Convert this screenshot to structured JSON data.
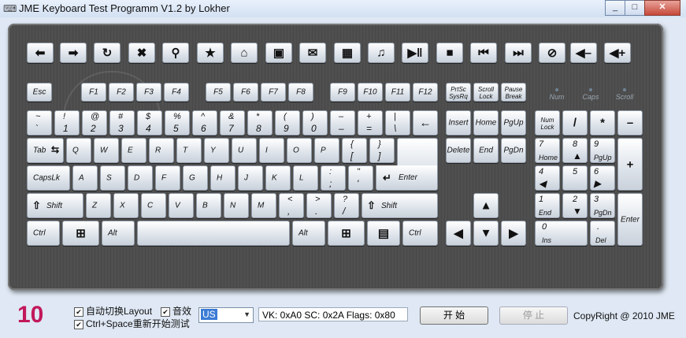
{
  "window": {
    "title": "JME Keyboard Test Programm V1.2 by Lokher",
    "min": "_",
    "max": "□",
    "close": "✕"
  },
  "toprow": [
    "⬅",
    "➡",
    "↻",
    "✖",
    "⚲",
    "★",
    "⌂",
    "▣",
    "✉",
    "▦",
    "♫",
    "▶‖",
    "■",
    "⏮",
    "⏭",
    "⊘",
    "◀–",
    "◀+"
  ],
  "fn": {
    "esc": "Esc",
    "f1": "F1",
    "f2": "F2",
    "f3": "F3",
    "f4": "F4",
    "f5": "F5",
    "f6": "F6",
    "f7": "F7",
    "f8": "F8",
    "f9": "F9",
    "f10": "F10",
    "f11": "F11",
    "f12": "F12",
    "prtsc1": "PrtSc",
    "prtsc2": "SysRq",
    "scroll1": "Scroll",
    "scroll2": "Lock",
    "pause1": "Pause",
    "pause2": "Break"
  },
  "leds": [
    "Num",
    "Caps",
    "Scroll"
  ],
  "num": [
    [
      "~",
      "`"
    ],
    [
      "!",
      "1"
    ],
    [
      "@",
      "2"
    ],
    [
      "#",
      "3"
    ],
    [
      "$",
      "4"
    ],
    [
      "%",
      "5"
    ],
    [
      "^",
      "6"
    ],
    [
      "&",
      "7"
    ],
    [
      "*",
      "8"
    ],
    [
      "(",
      "9"
    ],
    [
      ")",
      "0"
    ],
    [
      "–",
      "–"
    ],
    [
      "+",
      "="
    ],
    [
      "|",
      "\\"
    ]
  ],
  "backspace": "←",
  "tab": "Tab",
  "qrow": [
    "Q",
    "W",
    "E",
    "R",
    "T",
    "Y",
    "U",
    "I",
    "O",
    "P"
  ],
  "brackets": [
    [
      "{",
      "["
    ],
    [
      "}",
      "]"
    ]
  ],
  "caps": "CapsLk",
  "arow": [
    "A",
    "S",
    "D",
    "F",
    "G",
    "H",
    "J",
    "K",
    "L"
  ],
  "semi": [
    ":",
    ";"
  ],
  "quote": [
    "\"",
    "'"
  ],
  "enter": "Enter",
  "shift": "Shift",
  "zrow": [
    "Z",
    "X",
    "C",
    "V",
    "B",
    "N",
    "M"
  ],
  "lt": [
    "<",
    ","
  ],
  "gt": [
    ">",
    "."
  ],
  "qm": [
    "?",
    "/"
  ],
  "ctrl": "Ctrl",
  "alt": "Alt",
  "nav": {
    "insert": "Insert",
    "home": "Home",
    "pgup": "PgUp",
    "delete": "Delete",
    "end": "End",
    "pgdn": "PgDn",
    "up": "▲",
    "left": "◀",
    "down": "▼",
    "right": "▶"
  },
  "pad": {
    "numlock1": "Num",
    "numlock2": "Lock",
    "div": "/",
    "mul": "*",
    "sub": "–",
    "add": "+",
    "k7": [
      "7",
      "Home"
    ],
    "k8": [
      "8",
      "▲"
    ],
    "k9": [
      "9",
      "PgUp"
    ],
    "k4": [
      "4",
      "◀"
    ],
    "k5": [
      "5",
      ""
    ],
    "k6": [
      "6",
      "▶"
    ],
    "k1": [
      "1",
      "End"
    ],
    "k2": [
      "2",
      "▼"
    ],
    "k3": [
      "3",
      "PgDn"
    ],
    "k0": [
      "0",
      "Ins"
    ],
    "kdot": [
      ".",
      "Del"
    ],
    "enter": "Enter"
  },
  "bottom": {
    "counter": "10",
    "autoswitch": "自动切换Layout",
    "sound": "音效",
    "restart": "Ctrl+Space重新开始测试",
    "layout": "US",
    "info": "VK: 0xA0  SC: 0x2A  Flags: 0x80",
    "start": "开 始",
    "stop": "停 止",
    "copyright": "CopyRight @ 2010 JME"
  }
}
